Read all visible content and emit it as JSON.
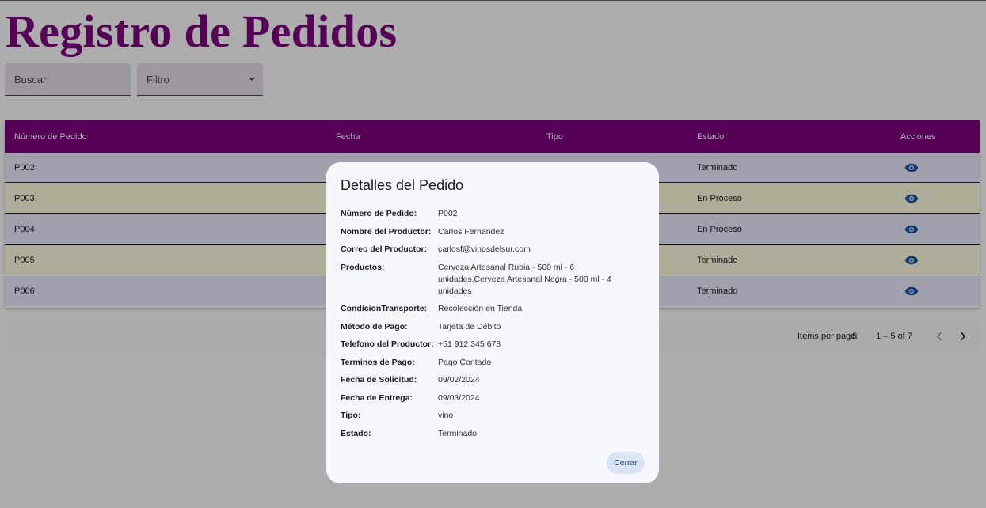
{
  "page": {
    "title": "Registro de Pedidos"
  },
  "controls": {
    "search_label": "Buscar",
    "filter_label": "Filtro"
  },
  "colors": {
    "header": "#800080",
    "row_odd": "#ececff",
    "row_even": "#ffffe0",
    "eye_icon": "#1a56a6"
  },
  "table": {
    "columns": [
      "Número de Pedido",
      "Fecha",
      "Tipo",
      "Estado",
      "Acciones"
    ],
    "rows": [
      {
        "pedido": "P002",
        "estado": "Terminado",
        "accion_icon": "eye-icon"
      },
      {
        "pedido": "P003",
        "estado": "En Proceso",
        "accion_icon": "eye-icon"
      },
      {
        "pedido": "P004",
        "estado": "En Proceso",
        "accion_icon": "eye-icon"
      },
      {
        "pedido": "P005",
        "estado": "Terminado",
        "accion_icon": "eye-icon"
      },
      {
        "pedido": "P006",
        "estado": "Terminado",
        "accion_icon": "eye-icon"
      }
    ]
  },
  "paginator": {
    "items_per_page_label": "Items per page:",
    "items_per_page": "5",
    "range": "1 – 5 of 7"
  },
  "dialog": {
    "title": "Detalles del Pedido",
    "fields": [
      {
        "label": "Número de Pedido:",
        "value": "P002"
      },
      {
        "label": "Nombre del Productor:",
        "value": "Carlos Fernandez"
      },
      {
        "label": "Correo del Productor:",
        "value": "carlosf@vinosdelsur.com"
      },
      {
        "label": "Productos:",
        "value": "Cerveza Artesanal Rubia - 500 ml - 6 unidades,Cerveza Artesanal Negra - 500 ml - 4 unidades"
      },
      {
        "label": "CondicionTransporte:",
        "value": "Recolección en Tienda"
      },
      {
        "label": "Método de Pago:",
        "value": "Tarjeta de Débito"
      },
      {
        "label": "Telefono del Productor:",
        "value": "+51 912 345 678"
      },
      {
        "label": "Terminos de Pago:",
        "value": "Pago Contado"
      },
      {
        "label": "Fecha de Solicitud:",
        "value": "09/02/2024"
      },
      {
        "label": "Fecha de Entrega:",
        "value": "09/03/2024"
      },
      {
        "label": "Tipo:",
        "value": "vino"
      },
      {
        "label": "Estado:",
        "value": "Terminado"
      }
    ],
    "close_label": "Cerrar"
  }
}
